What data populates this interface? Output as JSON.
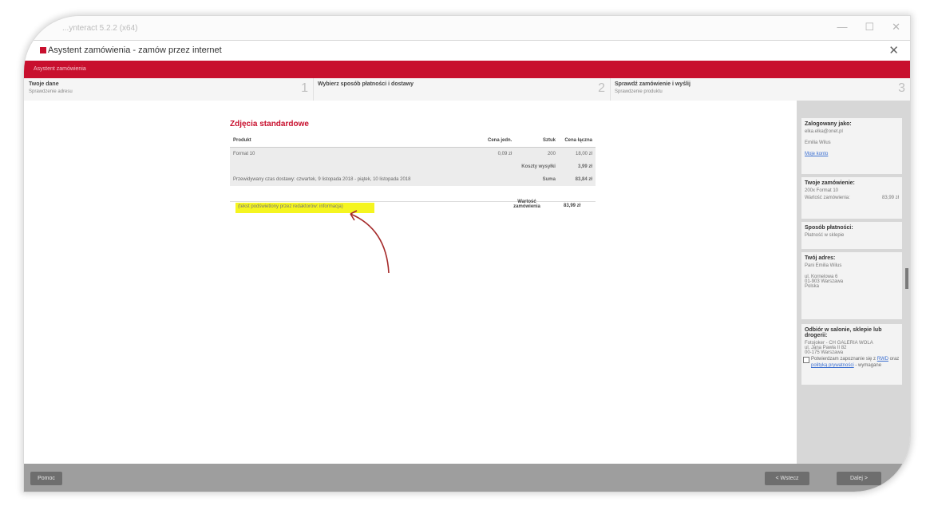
{
  "window": {
    "title": "...ynteract 5.2.2 (x64)"
  },
  "dialog": {
    "title": "Asystent zamówienia - zamów przez internet",
    "close": "✕"
  },
  "redbar": {
    "label": "Asystent zamówienia"
  },
  "steps": [
    {
      "title": "Twoje dane",
      "subtitle": "Sprawdzenie adresu",
      "number": "1"
    },
    {
      "title": "Wybierz sposób płatności i dostawy",
      "subtitle": "",
      "number": "2"
    },
    {
      "title": "Sprawdź zamówienie i wyślij",
      "subtitle": "Sprawdzenie produktu",
      "number": "3"
    }
  ],
  "order": {
    "section_title": "Zdjęcia standardowe",
    "columns": [
      "Produkt",
      "Cena jedn.",
      "Sztuk",
      "Cena łączna"
    ],
    "rows": [
      {
        "product": "Format 10",
        "unit_price": "0,09 zł",
        "qty": "200",
        "total": "18,00 zł"
      }
    ],
    "shipping_label": "Koszty wysyłki",
    "shipping_value": "3,99 zł",
    "delivery_text": "Przewidywany czas dostawy: czwartek, 9 listopada 2018 - piątek, 10 listopada 2018",
    "sum_label": "Suma",
    "sum_value": "83,84 zł",
    "note": "(tekst podświetlony przez redaktorów: informacja)",
    "payment_label": "Wartość zamówienia",
    "payment_value": "83,99 zł"
  },
  "sidebar": {
    "logged": {
      "title": "Zalogowany jako:",
      "email": "elka.elka@onet.pl",
      "name": "Emilia Wilus",
      "link": "Moje konto"
    },
    "your_order": {
      "title": "Twoje zamówienie:",
      "item": "200x Format 10",
      "value_label": "Wartość zamówienia:",
      "value": "83,99 zł"
    },
    "payment": {
      "title": "Sposób płatności:",
      "value": "Płatność w sklepie"
    },
    "address": {
      "title": "Twój adres:",
      "name": "Pani Emilia Wilus",
      "street": "ul. Kornelowa 6",
      "city": "01-903 Warszawa",
      "country": "Polska"
    },
    "pickup": {
      "title": "Odbiór w salonie, sklepie lub drogerii:",
      "line1": "Fotojoker - CH GALERIA WOLA",
      "line2": "ul. Jana Pawła II 82",
      "line3": "00-175 Warszawa"
    }
  },
  "consent": {
    "text_pre": "Potwierdzam zapoznanie się z",
    "link1": "RWD",
    "mid": "oraz",
    "link2": "polityką prywatności",
    "text_post": "- wymagane"
  },
  "footer": {
    "left_button": "Pomoc",
    "back_button": "< Wstecz",
    "next_button": "Dalej >"
  },
  "colors": {
    "accent": "#c8102e",
    "highlight": "#f5f520",
    "sidebar": "#d7d7d7",
    "footer": "#9e9e9e"
  }
}
